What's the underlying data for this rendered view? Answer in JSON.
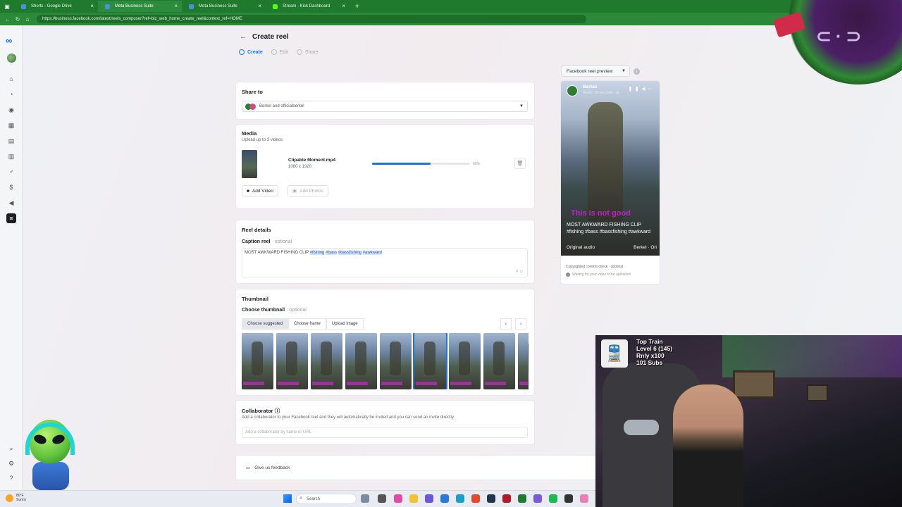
{
  "browser": {
    "tabs": [
      {
        "label": "Shorts - Google Drive",
        "active": false,
        "favicon_color": "#4a90e2"
      },
      {
        "label": "Meta Business Suite",
        "active": true,
        "favicon_color": "#2d88ff"
      },
      {
        "label": "Meta Business Suite",
        "active": false,
        "favicon_color": "#2d88ff"
      },
      {
        "label": "Stream - Kick Dashboard",
        "active": false,
        "favicon_color": "#53fc18"
      }
    ],
    "new_tab": "+",
    "url": "https://business.facebook.com/latest/reels_composer?ref=biz_web_home_create_reel&context_ref=HOME"
  },
  "page": {
    "title": "Create reel",
    "steps": [
      "Create",
      "Edit",
      "Share"
    ],
    "active_step": 0
  },
  "share": {
    "heading": "Share to",
    "value": "Berkel and officialberkel"
  },
  "media": {
    "heading": "Media",
    "subtitle": "Upload up to 3 videos.",
    "file_name": "Clipable Moment.mp4",
    "file_dims": "1080 x 1920",
    "progress_pct": 60,
    "progress_label": "60%",
    "add_video": "Add Video",
    "add_photos": "Add Photos"
  },
  "details": {
    "heading": "Reel details",
    "caption_label": "Caption reel",
    "caption_optional": "· optional",
    "caption_plain": "MOST AWKWARD FISHING CLIP ",
    "caption_tags": [
      "#fishing",
      "#bass",
      "#bassfishing",
      "#awkward"
    ]
  },
  "thumbnail": {
    "heading": "Thumbnail",
    "choose_label": "Choose thumbnail",
    "choose_optional": "· optional",
    "tabs": [
      "Choose suggested",
      "Choose frame",
      "Upload image"
    ],
    "count": 9,
    "selected_index": 5
  },
  "collaborator": {
    "heading": "Collaborator",
    "subtitle": "Add a collaborator to your Facebook reel and they will automatically be invited and you can send an invite directly.",
    "placeholder": "Add a collaborator by name or URL"
  },
  "feedback": {
    "label": "Give us feedback"
  },
  "preview": {
    "dropdown": "Facebook reel preview",
    "page_name": "Berkel",
    "meta": "Reels · 56 seconds · ",
    "overlay_text": "This is not good",
    "caption": "MOST AWKWARD FISHING CLIP #fishing #bass #bassfishing #awkward",
    "audio_left": "Original audio",
    "audio_right": "Berkel · Ori",
    "copyright_check": "Copyrighted content check · optional",
    "waiting": "Waiting for your video to be uploaded"
  },
  "webcam": {
    "alert_line1": "Top Train",
    "alert_line2": "Level 6  (145)",
    "alert_line3": "Rnly x100",
    "alert_line4": "101 Subs"
  },
  "taskbar": {
    "weather_temp": "80°F",
    "weather_desc": "Sunny",
    "search_label": "Search"
  },
  "colors": {
    "accent": "#1b74e4",
    "browser_green": "#1f7a2e",
    "overlay_magenta": "#c020d0"
  }
}
